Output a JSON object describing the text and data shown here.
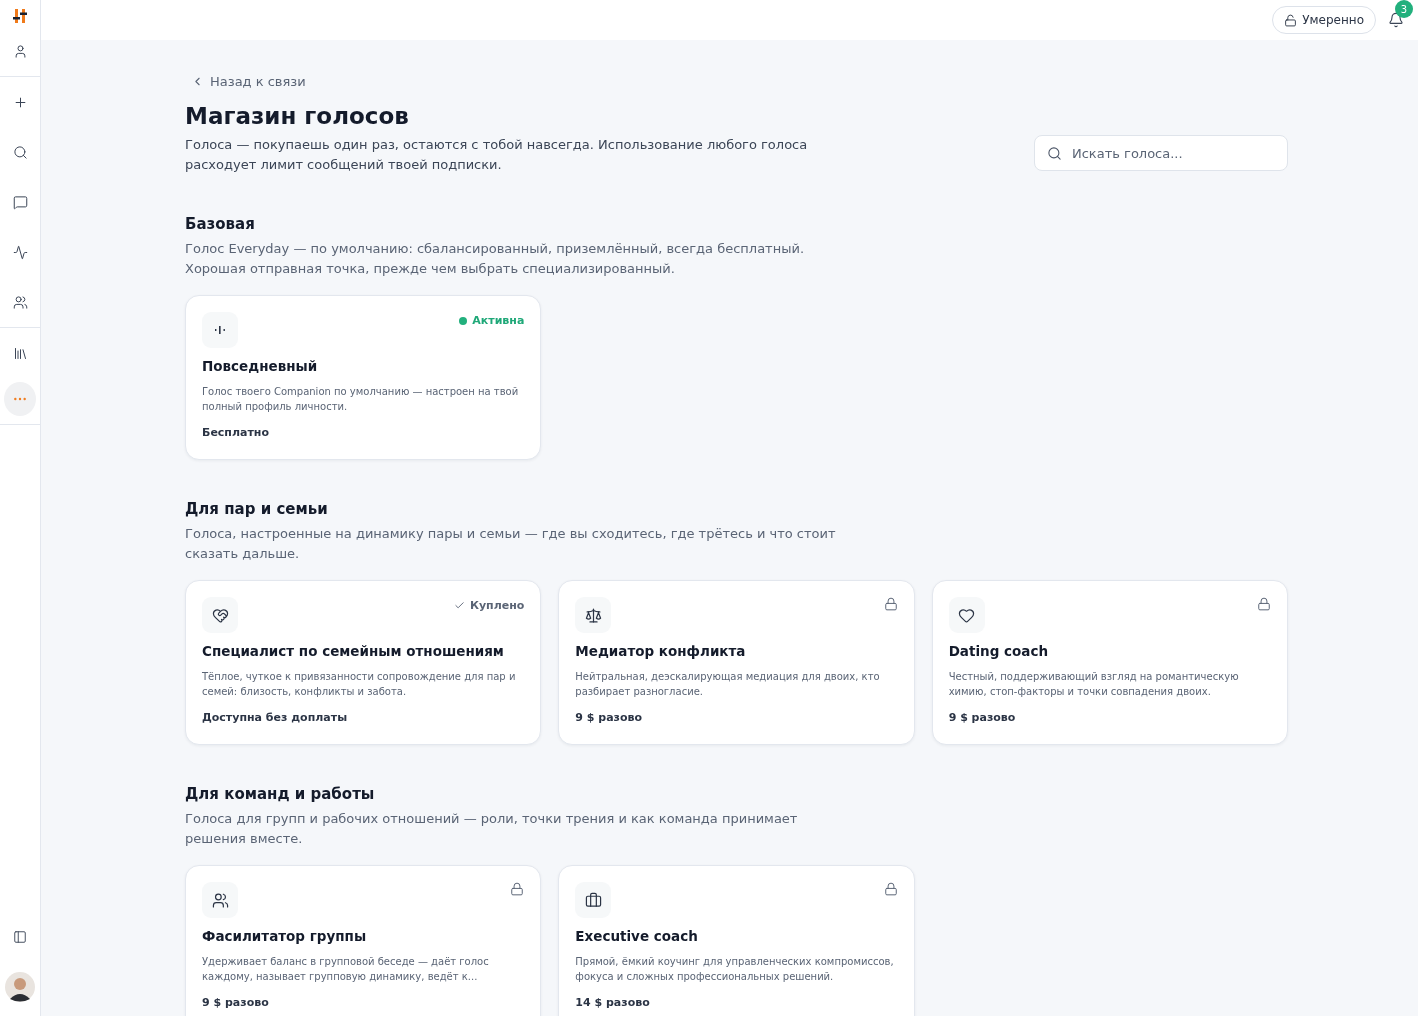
{
  "topbar": {
    "mode_button": "Умеренно",
    "notifications": "3"
  },
  "sidebar": {
    "items": [
      {
        "kind": "user",
        "selected": false
      },
      {
        "kind": "plus",
        "selected": false
      },
      {
        "kind": "search",
        "selected": false
      },
      {
        "kind": "chat",
        "selected": false
      },
      {
        "kind": "pulse",
        "selected": false
      },
      {
        "kind": "users",
        "selected": false
      },
      {
        "kind": "library",
        "selected": false
      },
      {
        "kind": "more",
        "selected": true
      }
    ]
  },
  "back_link": "Назад к связи",
  "title": "Магазин голосов",
  "intro": "Голоса — покупаешь один раз, остаются с тобой навсегда. Использование любого голоса расходует лимит сообщений твоей подписки.",
  "search": {
    "placeholder": "Искать голоса..."
  },
  "sections": [
    {
      "title": "Базовая",
      "description": "Голос Everyday — по умолчанию: сбалансированный, приземлённый, всегда бесплатный. Хорошая отправная точка, прежде чем выбрать специализированный.",
      "cards": [
        {
          "kind": "wave",
          "badge": {
            "kind": "active",
            "text": "Активна"
          },
          "name": "Повседневный",
          "description": "Голос твоего Companion по умолчанию — настроен на твой полный профиль личности.",
          "price": "Бесплатно"
        }
      ]
    },
    {
      "title": "Для пар и семьи",
      "description": "Голоса, настроенные на динамику пары и семьи — где вы сходитесь, где трётесь и что стоит сказать дальше.",
      "cards": [
        {
          "kind": "handshake",
          "badge": {
            "kind": "purchased",
            "text": "Куплено"
          },
          "name": "Специалист по семейным отношениям",
          "description": "Тёплое, чуткое к привязанности сопровождение для пар и семей: близость, конфликты и забота.",
          "price": "Доступна без доплаты"
        },
        {
          "kind": "scale",
          "badge": {
            "kind": "locked"
          },
          "name": "Медиатор конфликта",
          "description": "Нейтральная, деэскалирующая медиация для двоих, кто разбирает разногласие.",
          "price": "9 $ разово"
        },
        {
          "kind": "heart",
          "badge": {
            "kind": "locked"
          },
          "name": "Dating coach",
          "description": "Честный, поддерживающий взгляд на романтическую химию, стоп-факторы и точки совпадения двоих.",
          "price": "9 $ разово"
        }
      ]
    },
    {
      "title": "Для команд и работы",
      "description": "Голоса для групп и рабочих отношений — роли, точки трения и как команда принимает решения вместе.",
      "cards": [
        {
          "kind": "users",
          "badge": {
            "kind": "locked"
          },
          "name": "Фасилитатор группы",
          "description": "Удерживает баланс в групповой беседе — даёт голос каждому, называет групповую динамику, ведёт к...",
          "price": "9 $ разово"
        },
        {
          "kind": "briefcase",
          "badge": {
            "kind": "locked"
          },
          "name": "Executive coach",
          "description": "Прямой, ёмкий коучинг для управленческих компромиссов, фокуса и сложных профессиональных решений.",
          "price": "14 $ разово"
        }
      ]
    }
  ]
}
